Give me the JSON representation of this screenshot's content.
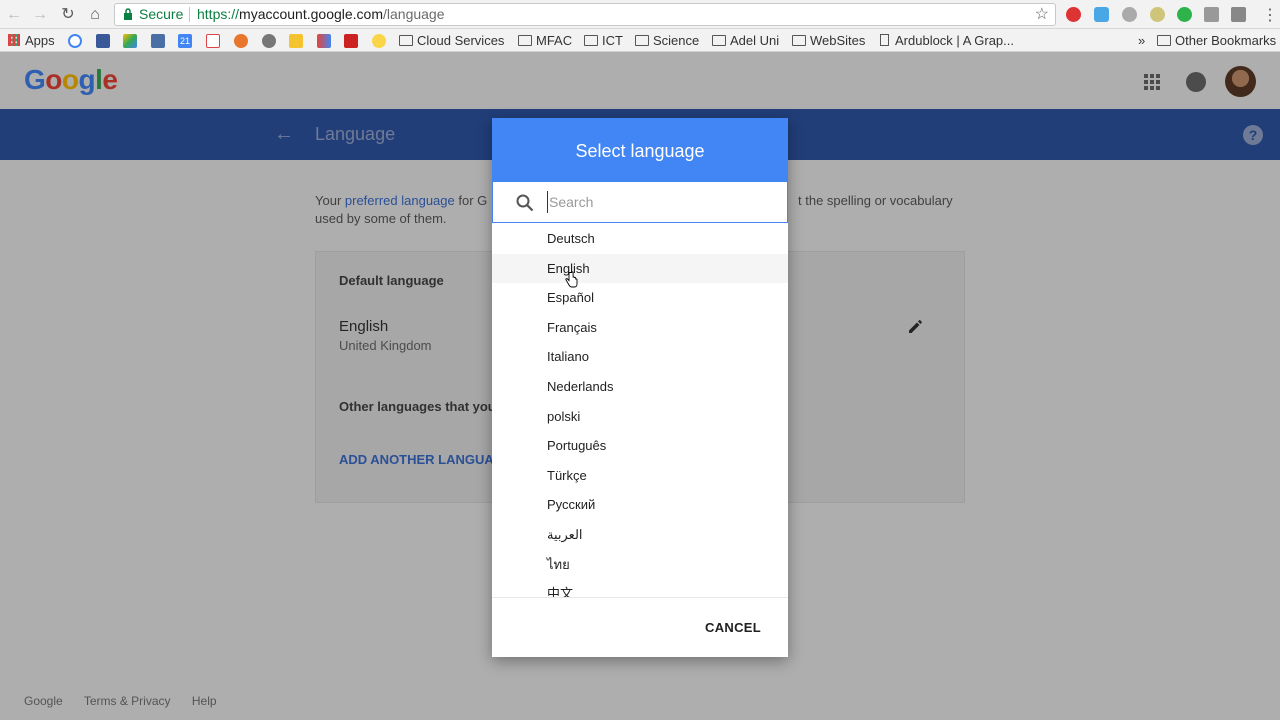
{
  "browser": {
    "secure_label": "Secure",
    "url_scheme": "https://",
    "url_host": "myaccount.google.com",
    "url_path": "/language"
  },
  "bookmarks": {
    "apps": "Apps",
    "calendar_day": "21",
    "items": [
      "Cloud Services",
      "MFAC",
      "ICT",
      "Science",
      "Adel Uni",
      "WebSites"
    ],
    "page_item": "Ardublock | A Grap...",
    "overflow": "»",
    "other": "Other Bookmarks"
  },
  "header": {
    "logo_letters": [
      "G",
      "o",
      "o",
      "g",
      "l",
      "e"
    ],
    "logo_colors": [
      "#4285f4",
      "#ea4335",
      "#fbbc05",
      "#4285f4",
      "#34a853",
      "#ea4335"
    ]
  },
  "page": {
    "title": "Language",
    "intro_prefix": "Your ",
    "intro_link": "preferred language",
    "intro_mid": " for G",
    "intro_right": "t the spelling or vocabulary",
    "intro_line2": "used by some of them.",
    "default_label": "Default language",
    "default_lang": "English",
    "default_region": "United Kingdom",
    "other_label": "Other languages that you",
    "add_button": "ADD ANOTHER LANGUAG"
  },
  "footer": {
    "links": [
      "Google",
      "Terms & Privacy",
      "Help"
    ]
  },
  "dialog": {
    "title": "Select language",
    "search_placeholder": "Search",
    "languages": [
      "Deutsch",
      "English",
      "Español",
      "Français",
      "Italiano",
      "Nederlands",
      "polski",
      "Português",
      "Türkçe",
      "Русский",
      "العربية",
      "ไทย",
      "中文"
    ],
    "cancel_label": "CANCEL"
  },
  "colors": {
    "accent_blue": "#4285f4",
    "header_blue": "#2f56a8",
    "link_blue": "#3b6fd1",
    "secure_green": "#0b8043"
  }
}
